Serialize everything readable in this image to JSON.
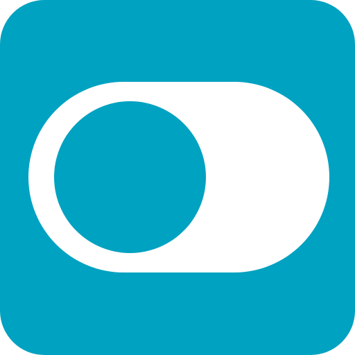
{
  "icon": {
    "name": "toggle-switch-icon",
    "background_color": "#00a2c1",
    "track_color": "#ffffff",
    "knob_color": "#00a2c1",
    "toggle_state": "off"
  }
}
